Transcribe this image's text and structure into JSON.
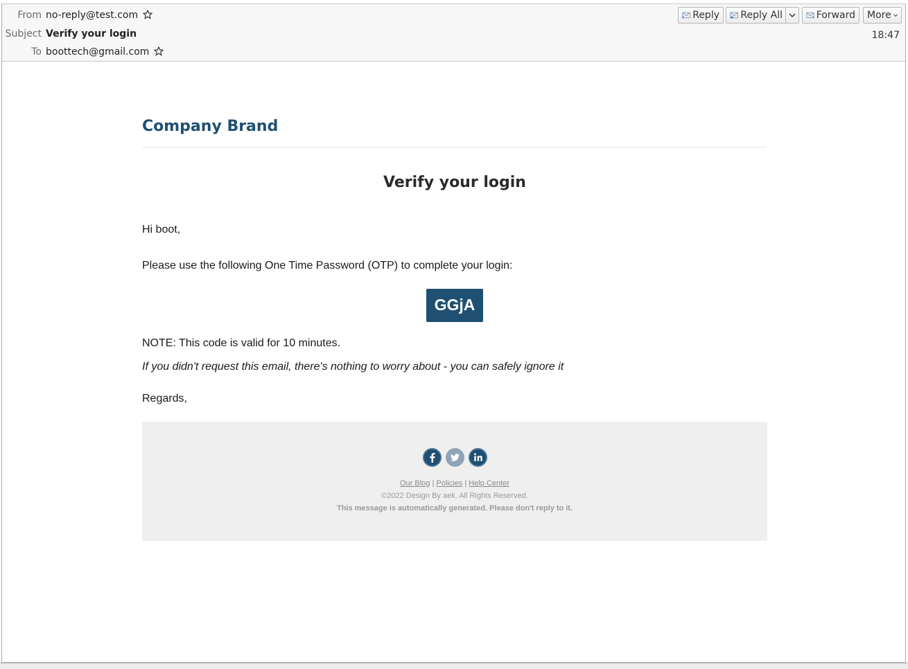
{
  "header": {
    "from_label": "From",
    "from_value": "no-reply@test.com",
    "subject_label": "Subject",
    "subject_value": "Verify your login",
    "to_label": "To",
    "to_value": "boottech@gmail.com",
    "time": "18:47"
  },
  "toolbar": {
    "reply": "Reply",
    "reply_all": "Reply All",
    "forward": "Forward",
    "more": "More"
  },
  "email": {
    "brand": "Company Brand",
    "title": "Verify your login",
    "greeting": "Hi boot,",
    "instruction": "Please use the following One Time Password (OTP) to complete your login:",
    "otp": "GGjA",
    "note": "NOTE: This code is valid for 10 minutes.",
    "ignore": "If you didn't request this email, there's nothing to worry about - you can safely ignore it",
    "regards": "Regards,"
  },
  "footer": {
    "social": [
      "facebook-icon",
      "twitter-icon",
      "linkedin-icon"
    ],
    "link_blog": "Our Blog",
    "link_policies": "Policies",
    "link_help": "Help Center",
    "separator": " | ",
    "copyright": "©2022 Design By aek. All Rights Reserved.",
    "auto_note": "This message is automatically generated. Please don't reply to it."
  },
  "colors": {
    "brand": "#1f5072",
    "footer_bg": "#efefef"
  }
}
